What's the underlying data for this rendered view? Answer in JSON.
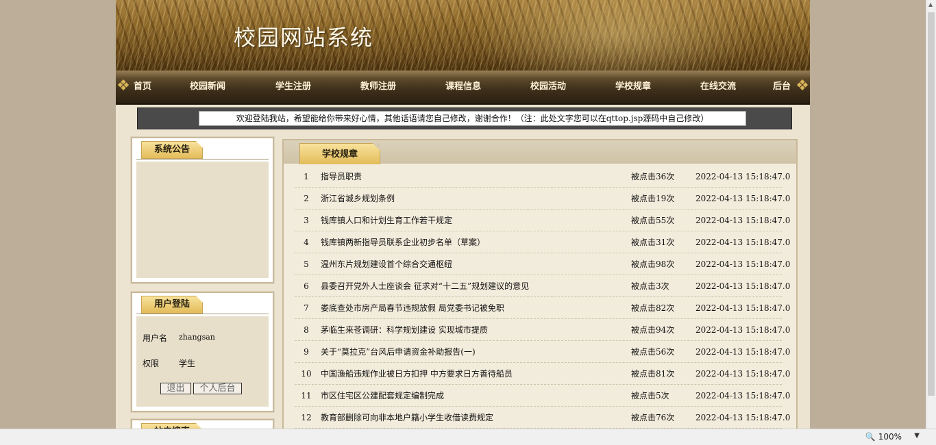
{
  "site": {
    "title": "校园网站系统"
  },
  "nav": {
    "items": [
      {
        "label": "首页"
      },
      {
        "label": "校园新闻"
      },
      {
        "label": "学生注册"
      },
      {
        "label": "教师注册"
      },
      {
        "label": "课程信息"
      },
      {
        "label": "校园活动"
      },
      {
        "label": "学校规章"
      },
      {
        "label": "在线交流"
      },
      {
        "label": "后台"
      }
    ]
  },
  "welcome": {
    "text": "欢迎登陆我站，希望能给你带来好心情，其他话语请您自己修改，谢谢合作！（注：此处文字您可以在qttop.jsp源码中自己修改）"
  },
  "notice": {
    "title": "系统公告"
  },
  "login": {
    "title": "用户登陆",
    "username_label": "用户名",
    "username": "zhangsan",
    "role_label": "权限",
    "role": "学生",
    "logout_button": "退出",
    "personal_button": "个人后台"
  },
  "third_panel": {
    "title": "站内搜索"
  },
  "main": {
    "title": "学校规章",
    "rows": [
      {
        "idx": "1",
        "title": "指导员职责",
        "hits": "被点击36次",
        "time": "2022-04-13 15:18:47.0"
      },
      {
        "idx": "2",
        "title": "浙江省城乡规划条例",
        "hits": "被点击19次",
        "time": "2022-04-13 15:18:47.0"
      },
      {
        "idx": "3",
        "title": "钱库镇人口和计划生育工作若干规定",
        "hits": "被点击55次",
        "time": "2022-04-13 15:18:47.0"
      },
      {
        "idx": "4",
        "title": "钱库镇两新指导员联系企业初步名单（草案）",
        "hits": "被点击31次",
        "time": "2022-04-13 15:18:47.0"
      },
      {
        "idx": "5",
        "title": "温州东片规划建设首个综合交通枢纽",
        "hits": "被点击98次",
        "time": "2022-04-13 15:18:47.0"
      },
      {
        "idx": "6",
        "title": "县委召开党外人士座谈会 征求对“十二五”规划建议的意见",
        "hits": "被点击3次",
        "time": "2022-04-13 15:18:47.0"
      },
      {
        "idx": "7",
        "title": "娄底查处市房产局春节违规放假 局党委书记被免职",
        "hits": "被点击82次",
        "time": "2022-04-13 15:18:47.0"
      },
      {
        "idx": "8",
        "title": "茅临生来苍调研：科学规划建设 实现城市提质",
        "hits": "被点击94次",
        "time": "2022-04-13 15:18:47.0"
      },
      {
        "idx": "9",
        "title": "关于“莫拉克”台风后申请资金补助报告(一)",
        "hits": "被点击56次",
        "time": "2022-04-13 15:18:47.0"
      },
      {
        "idx": "10",
        "title": "中国渔船违规作业被日方扣押 中方要求日方善待船员",
        "hits": "被点击81次",
        "time": "2022-04-13 15:18:47.0"
      },
      {
        "idx": "11",
        "title": "市区住宅区公建配套规定编制完成",
        "hits": "被点击5次",
        "time": "2022-04-13 15:18:47.0"
      },
      {
        "idx": "12",
        "title": "教育部删除可向非本地户籍小学生收借读费规定",
        "hits": "被点击76次",
        "time": "2022-04-13 15:18:47.0"
      }
    ]
  },
  "browser": {
    "zoom": "100%"
  }
}
